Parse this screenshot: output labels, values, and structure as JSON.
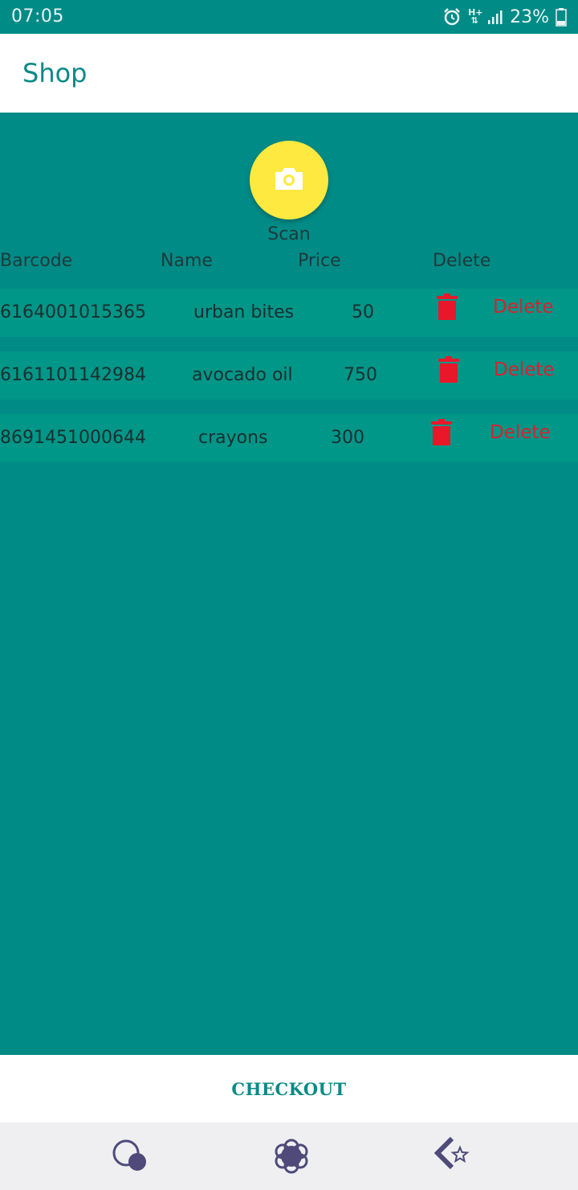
{
  "status_bar": {
    "time": "07:05",
    "network": "H+",
    "battery": "23%"
  },
  "app_bar": {
    "title": "Shop"
  },
  "scan": {
    "label": "Scan"
  },
  "table": {
    "headers": {
      "barcode": "Barcode",
      "name": "Name",
      "price": "Price",
      "delete": "Delete"
    },
    "rows": [
      {
        "barcode": "6164001015365",
        "name": "urban bites",
        "price": "50",
        "delete_label": "Delete"
      },
      {
        "barcode": "6161101142984",
        "name": "avocado oil",
        "price": "750",
        "delete_label": "Delete"
      },
      {
        "barcode": "8691451000644",
        "name": "crayons",
        "price": "300",
        "delete_label": "Delete"
      }
    ]
  },
  "checkout": {
    "label": "CHECKOUT"
  },
  "colors": {
    "primary": "#008b87",
    "row": "#009688",
    "accent_yellow": "#fde93f",
    "delete_red": "#d8222f",
    "nav_icon": "#4f4a7a"
  },
  "nav_icons": [
    "bubbles-icon",
    "settings-flower-icon",
    "back-star-icon"
  ]
}
